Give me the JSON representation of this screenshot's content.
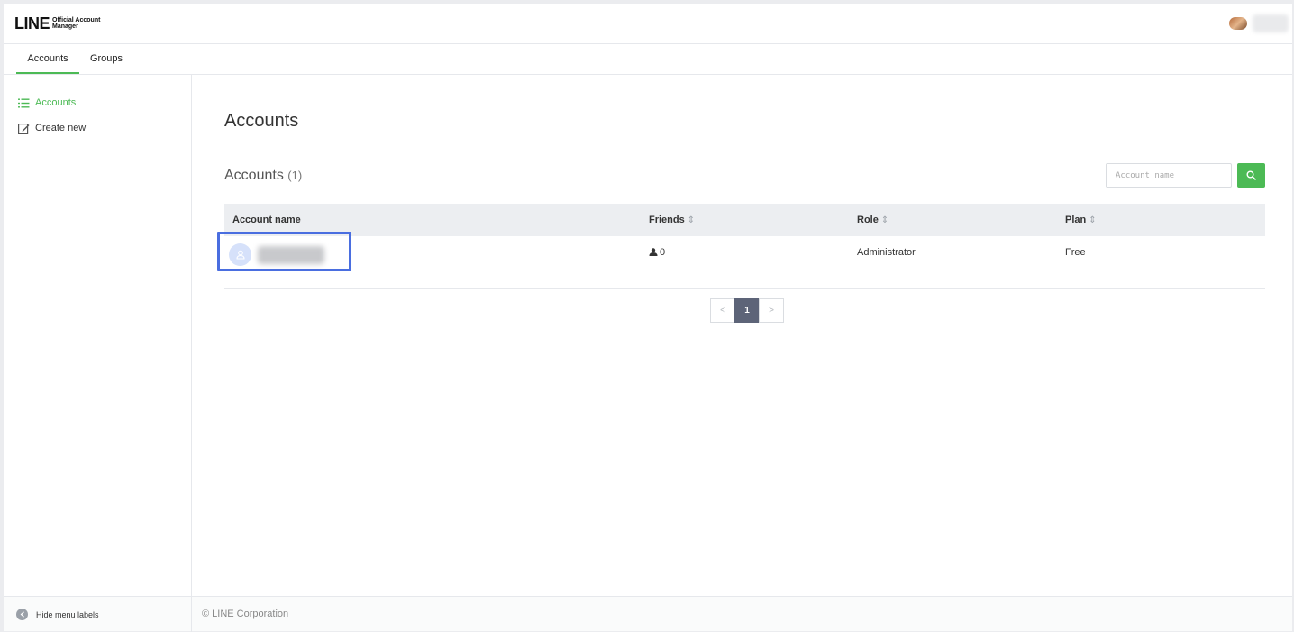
{
  "brand": {
    "main": "LINE",
    "sub_line1": "Official Account",
    "sub_line2": "Manager"
  },
  "tabs": [
    {
      "label": "Accounts",
      "active": true
    },
    {
      "label": "Groups",
      "active": false
    }
  ],
  "sidebar": {
    "items": [
      {
        "label": "Accounts",
        "icon": "list-icon",
        "active": true
      },
      {
        "label": "Create new",
        "icon": "edit-icon",
        "active": false
      }
    ],
    "hide_labels": "Hide menu labels"
  },
  "main": {
    "title": "Accounts",
    "section_title": "Accounts",
    "section_count": "(1)",
    "search_placeholder": "Account name"
  },
  "table": {
    "columns": [
      {
        "label": "Account name",
        "sortable": false
      },
      {
        "label": "Friends",
        "sortable": true
      },
      {
        "label": "Role",
        "sortable": true
      },
      {
        "label": "Plan",
        "sortable": true
      }
    ],
    "rows": [
      {
        "account_name": "",
        "friends": "0",
        "role": "Administrator",
        "plan": "Free"
      }
    ]
  },
  "pagination": {
    "prev": "<",
    "current": "1",
    "next": ">"
  },
  "footer": {
    "copyright": "© LINE Corporation"
  },
  "colors": {
    "accent": "#4cba55",
    "highlight": "#4a6ee0",
    "pager_current": "#5d6478"
  }
}
